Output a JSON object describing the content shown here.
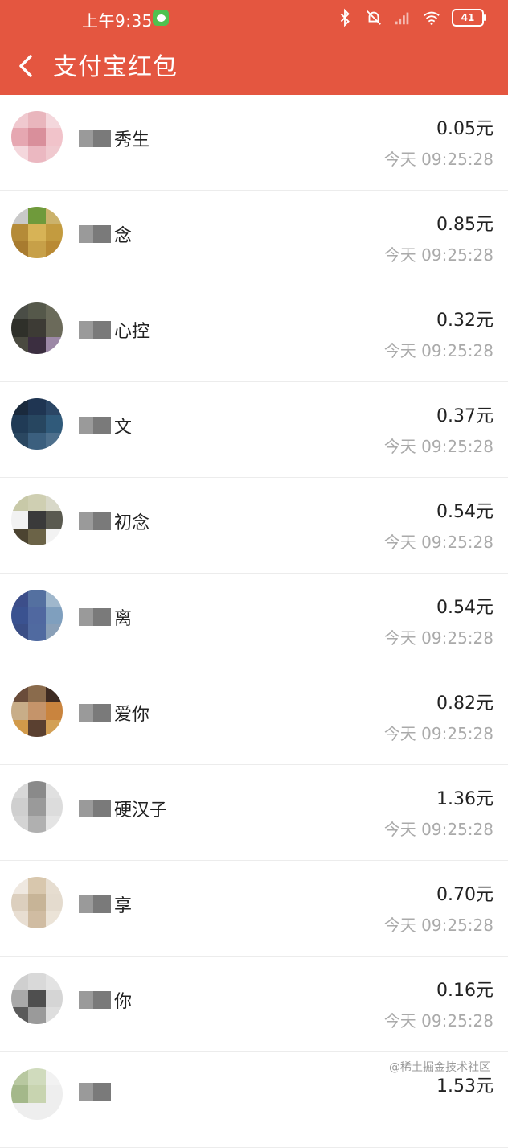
{
  "status_bar": {
    "time": "上午9:35",
    "battery": "41"
  },
  "header": {
    "title": "支付宝红包",
    "color": "#e45640"
  },
  "records": [
    {
      "name": "秀生",
      "amount": "0.05元",
      "time": "今天 09:25:28",
      "avatar_colors": [
        "#f0c9cf",
        "#e9b6bd",
        "#f4d7dc",
        "#e6a7b1",
        "#d98f9b",
        "#f1c3ca",
        "#f4d7dc",
        "#ebb8c1",
        "#f0c9cf"
      ]
    },
    {
      "name": "念",
      "amount": "0.85元",
      "time": "今天 09:25:28",
      "avatar_colors": [
        "#c9c9c9",
        "#6f9a3b",
        "#cbb26b",
        "#b58b38",
        "#d7b356",
        "#c39b3f",
        "#a87b2f",
        "#c7a048",
        "#b98a34"
      ]
    },
    {
      "name": "心控",
      "amount": "0.32元",
      "time": "今天 09:25:28",
      "avatar_colors": [
        "#4a4d46",
        "#55584a",
        "#6a6b5a",
        "#2f302a",
        "#3d3b35",
        "#6b6a5a",
        "#4a4a40",
        "#3b2e40",
        "#9c88a6"
      ]
    },
    {
      "name": "文",
      "amount": "0.37元",
      "time": "今天 09:25:28",
      "avatar_colors": [
        "#1a2a3d",
        "#1f3552",
        "#2b4665",
        "#203b56",
        "#274660",
        "#305a7a",
        "#2a4761",
        "#3b5f7e",
        "#4d6f8c"
      ]
    },
    {
      "name": "初念",
      "amount": "0.54元",
      "time": "今天 09:25:28",
      "avatar_colors": [
        "#c8c9a8",
        "#cfcfb2",
        "#d8d8c8",
        "#f2f2f2",
        "#3a3a3a",
        "#5a5a50",
        "#4c4431",
        "#6b6347",
        "#f2f2f2"
      ]
    },
    {
      "name": "离",
      "amount": "0.54元",
      "time": "今天 09:25:28",
      "avatar_colors": [
        "#3c4e8a",
        "#5470a0",
        "#9fb7cc",
        "#3a5290",
        "#5068a0",
        "#7f9fbe",
        "#3a4e86",
        "#506aa0",
        "#8aa0b8"
      ]
    },
    {
      "name": "爱你",
      "amount": "0.82元",
      "time": "今天 09:25:28",
      "avatar_colors": [
        "#6a4c3a",
        "#8a6b4c",
        "#3e2b22",
        "#c8ad88",
        "#c5946a",
        "#c9843e",
        "#d19a4a",
        "#5a4030",
        "#d3a055"
      ]
    },
    {
      "name": "硬汉子",
      "amount": "1.36元",
      "time": "今天 09:25:28",
      "avatar_colors": [
        "#d8d8d8",
        "#8a8a8a",
        "#e0e0e0",
        "#cfcfcf",
        "#9a9a9a",
        "#dcdcdc",
        "#d4d4d4",
        "#b0b0b0",
        "#e4e4e4"
      ]
    },
    {
      "name": "享",
      "amount": "0.70元",
      "time": "今天 09:25:28",
      "avatar_colors": [
        "#efe8e0",
        "#d8c7ad",
        "#e6ddd0",
        "#dccfbe",
        "#c7b497",
        "#e4dbce",
        "#e8ded2",
        "#d0bca2",
        "#ebe3d7"
      ]
    },
    {
      "name": "你",
      "amount": "0.16元",
      "time": "今天 09:25:28",
      "avatar_colors": [
        "#cfcfcf",
        "#d9d9d9",
        "#e3e3e3",
        "#a9a9a9",
        "#4f4f4f",
        "#d5d5d5",
        "#5a5a5a",
        "#9a9a9a",
        "#dedede"
      ]
    },
    {
      "name": "",
      "amount": "1.53元",
      "time": "",
      "avatar_colors": [
        "#b8c8a0",
        "#d0dbbd",
        "#f2f2f2",
        "#a4b88a",
        "#c8d4b0",
        "#eeeeee",
        "#eeeeee",
        "#eeeeee",
        "#eeeeee"
      ]
    }
  ],
  "watermark": "@稀土掘金技术社区"
}
